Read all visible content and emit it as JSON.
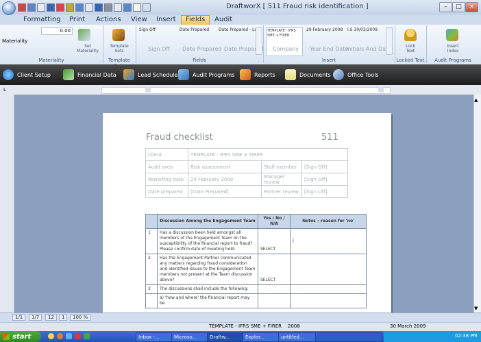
{
  "window": {
    "title": "DraftworX [ 511 Fraud risk identification ]",
    "minimize": "–",
    "maximize": "□",
    "close": "×"
  },
  "tabs": [
    "Formatting",
    "Print",
    "Actions",
    "View",
    "Insert",
    "Fields",
    "Audit"
  ],
  "ribbon": {
    "materiality": {
      "value": "0.00",
      "label": "Materiality",
      "group": "Materiality",
      "set_label": "Set\nMateriality"
    },
    "template_sets": {
      "label": "Template\nSets",
      "group": "Template Sets"
    },
    "fields": {
      "sign_off_header": "Sign Off",
      "sign_off_value": "Sign Off",
      "date_prepared_header": "Date Prepared",
      "date_prepared_value": "Date Prepared",
      "date_prepared_long_header": "Date Prepared - Long",
      "date_prepared_long_value": "Date Prepared",
      "group": "Fields"
    },
    "insert": {
      "company_header": "TEMPLATE - IFRS SME + FIRER",
      "company_value": "Company",
      "year_end_header": "29 February 2008",
      "year_end_value": "Year End Date",
      "initials_header": "I.S 30/03/2009",
      "initials_value": "Initials And Date",
      "group": "Insert"
    },
    "lock": {
      "label": "Lock\nText",
      "group": "Locked Text"
    },
    "audit": {
      "label": "Insert\nIndex",
      "group": "Audit Programs"
    }
  },
  "toolbar": [
    "Client Setup",
    "Financial Data",
    "Lead Schedules",
    "Audit Programs",
    "Reports",
    "Documents",
    "Office Tools"
  ],
  "document": {
    "title": "Fraud checklist",
    "number": "511",
    "info": [
      {
        "label": "Client",
        "value": "TEMPLATE - IFRS SME + FIRER",
        "label2": "",
        "value2": ""
      },
      {
        "label": "Audit area",
        "value": "Risk assessment",
        "label2": "Staff member",
        "value2": "[Sign Off]"
      },
      {
        "label": "Reporting date",
        "value": "29 February 2008",
        "label2": "Manager review",
        "value2": "[Sign Off]"
      },
      {
        "label": "Date prepared",
        "value": "[Date Prepared]",
        "label2": "Partner review",
        "value2": "[Sign Off]"
      }
    ],
    "discussion": {
      "headers": [
        "Discussion Among the Engagement Team",
        "Yes / No / N/A",
        "Notes – reason for 'no'"
      ],
      "rows": [
        {
          "num": "1",
          "text": "Has a discussion been held amongst all members of the Engagement Team on the susceptibility of the financial report to fraud? Please confirm date of meeting held.",
          "answer": "SELECT",
          "notes": "|"
        },
        {
          "num": "2",
          "text": "Has the Engagement Partner communicated any matters regarding fraud consideration and identified issues to the Engagement Team members not present at the Team discussion above?",
          "answer": "SELECT",
          "notes": ""
        },
        {
          "num": "3",
          "text": "The discussions shall include the following:",
          "answer": "",
          "notes": ""
        },
        {
          "num": "",
          "text": "a) 'how and where' the financial report may be",
          "answer": "",
          "notes": ""
        }
      ]
    }
  },
  "status": {
    "page_a": "1/1",
    "page_b": "1/7",
    "page_c": "12",
    "page_d": "1",
    "zoom": "100 %",
    "company": "TEMPLATE - IFRS SME + FIRER",
    "year": "2008",
    "date": "30 March 2009"
  },
  "taskbar": {
    "start": "start",
    "tasks": [
      "Inbox -...",
      "Microso...",
      "Draftw...",
      "Explor...",
      "untitled..."
    ],
    "clock": "02:38 PM"
  }
}
